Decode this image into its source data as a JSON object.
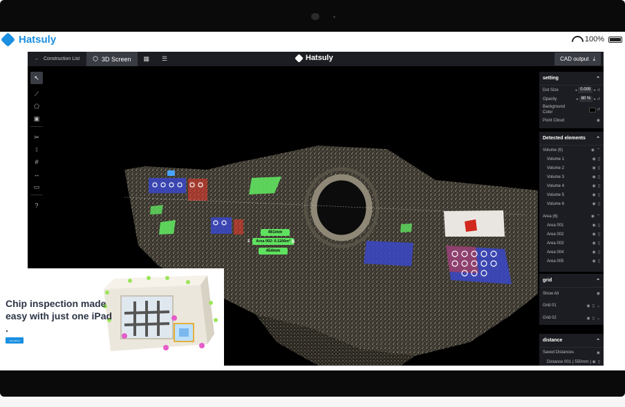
{
  "device": {
    "brand": "Hatsuly",
    "battery": "100%"
  },
  "topbar": {
    "back_label": "Construction List",
    "tab_3d": "3D Screen",
    "app_title": "Hatsuly",
    "cad_button": "CAD output"
  },
  "scene": {
    "measure_top": "461mm",
    "measure_area": "Area 002: 0.1166m²",
    "measure_bottom": "454mm",
    "marker_left": "2",
    "marker_right": "B"
  },
  "setting": {
    "title": "setting",
    "dot_size_label": "Dot Size",
    "dot_size_value": "0.005",
    "opacity_label": "Opacity",
    "opacity_value": "80 %",
    "background_color_label": "Background Color",
    "point_cloud_label": "Point Cloud"
  },
  "detected": {
    "title": "Detected elements",
    "volume_group": "Volume (6)",
    "volumes": [
      "Volume 1",
      "Volume 2",
      "Volume 3",
      "Volume 4",
      "Volume 5",
      "Volume 6"
    ],
    "area_group": "Area (6)",
    "areas": [
      "Area 001",
      "Area 002",
      "Area 003",
      "Area 004",
      "Area 005"
    ]
  },
  "grid": {
    "title": "grid",
    "show_all": "Show All",
    "items": [
      "Grid 01",
      "Grid 02"
    ]
  },
  "distance": {
    "title": "distance",
    "saved": "Saved Distances",
    "item": "Distance 001 ( 550mm )"
  },
  "promo": {
    "headline": "Chip inspection made easy with just one iPad .",
    "button": "Get started"
  },
  "colors": {
    "accent": "#1b8fe0",
    "app_bar": "#1c1d22",
    "measure_green": "#5fe25f",
    "marker_red": "#e23b2b",
    "marker_blue": "#3a48c8"
  }
}
